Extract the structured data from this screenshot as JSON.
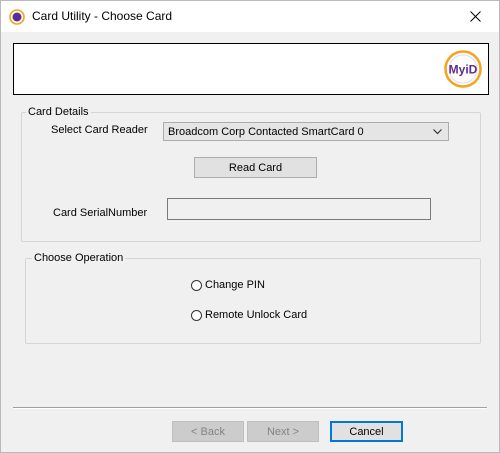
{
  "window": {
    "title": "Card Utility - Choose Card",
    "icon": "myid-icon"
  },
  "banner": {
    "logo_text": "MyiD",
    "logo_colors": {
      "ring": "#f7a21b",
      "text": "#5b2d8c"
    }
  },
  "card_details": {
    "legend": "Card Details",
    "reader_label": "Select Card Reader",
    "reader_selected": "Broadcom Corp Contacted SmartCard 0",
    "read_button": "Read Card",
    "serial_label": "Card SerialNumber",
    "serial_value": ""
  },
  "operation": {
    "legend": "Choose Operation",
    "options": [
      {
        "label": "Change PIN",
        "selected": false
      },
      {
        "label": "Remote Unlock Card",
        "selected": false
      }
    ]
  },
  "footer": {
    "back_label": "< Back",
    "next_label": "Next >",
    "cancel_label": "Cancel"
  },
  "colors": {
    "focus_border": "#0078d7",
    "window_bg": "#f0f0f0"
  }
}
